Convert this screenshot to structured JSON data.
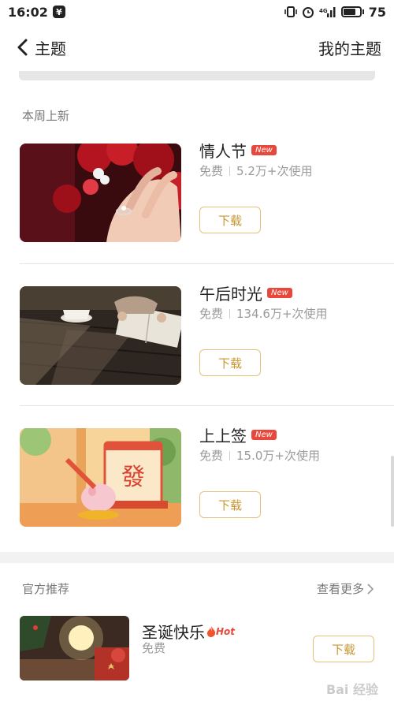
{
  "status_bar": {
    "time": "16:02",
    "battery": "75",
    "battery_level": 0.75
  },
  "header": {
    "title": "主题",
    "right_label": "我的主题"
  },
  "weekly": {
    "title": "本周上新",
    "items": [
      {
        "name": "情人节",
        "badge": "New",
        "free": "免费",
        "uses": "5.2万+次使用",
        "button": "下载"
      },
      {
        "name": "午后时光",
        "badge": "New",
        "free": "免费",
        "uses": "134.6万+次使用",
        "button": "下载"
      },
      {
        "name": "上上签",
        "badge": "New",
        "free": "免费",
        "uses": "15.0万+次使用",
        "button": "下载"
      }
    ],
    "fortune_char": "發"
  },
  "official": {
    "title": "官方推荐",
    "more": "查看更多",
    "item": {
      "name": "圣诞快乐",
      "badge": "Hot",
      "free": "免费",
      "button": "下载"
    }
  },
  "watermark": "Bai 经验",
  "colors": {
    "accent_gold": "#c9962e",
    "badge_red": "#e8483b"
  }
}
